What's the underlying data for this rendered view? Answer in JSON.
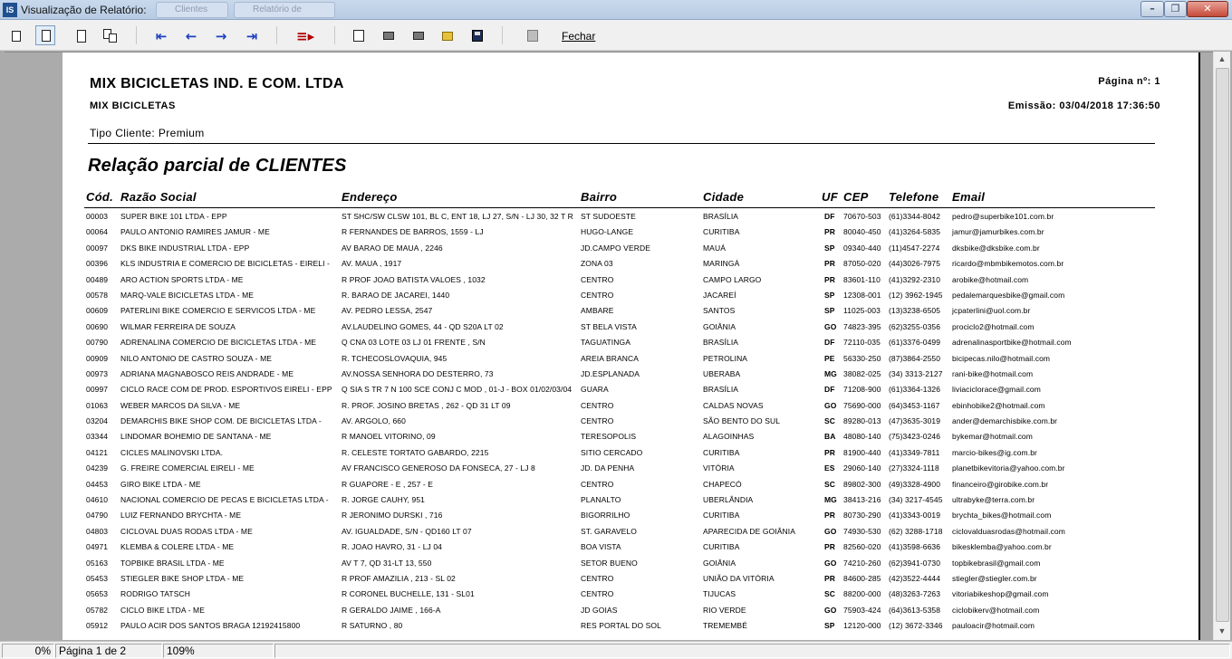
{
  "window": {
    "title": "Visualização de Relatório:",
    "ghost_tabs": [
      "Clientes",
      "Relatório de Clientes"
    ],
    "min_glyph": "–",
    "max_glyph": "❐",
    "close_glyph": "✕"
  },
  "toolbar": {
    "fechar_label": "Fechar",
    "icons": [
      "single-page-icon",
      "page-width-icon",
      "full-page-icon",
      "multi-page-icon",
      "first-page-icon",
      "previous-page-icon",
      "next-page-icon",
      "last-page-icon",
      "goto-page-icon",
      "copy-icon",
      "print-setup-icon",
      "print-icon",
      "open-icon",
      "save-icon",
      "export-icon"
    ]
  },
  "report": {
    "company": "MIX BICICLETAS IND. E COM. LTDA",
    "subcompany": "MIX BICICLETAS",
    "page_number": "Página nº: 1",
    "emission": "Emissão: 03/04/2018 17:36:50",
    "tipo_cliente": "Tipo Cliente: Premium",
    "title": "Relação parcial de CLIENTES",
    "columns": {
      "cod": "Cód.",
      "razao": "Razão Social",
      "endereco": "Endereço",
      "bairro": "Bairro",
      "cidade": "Cidade",
      "uf": "UF",
      "cep": "CEP",
      "telefone": "Telefone",
      "email": "Email"
    },
    "rows": [
      [
        "00003",
        "SUPER BIKE 101 LTDA - EPP",
        "ST SHC/SW CLSW 101, BL C, ENT 18, LJ 27, S/N - LJ 30, 32 T R",
        "ST SUDOESTE",
        "BRASÍLIA",
        "DF",
        "70670-503",
        "(61)3344-8042",
        "pedro@superbike101.com.br"
      ],
      [
        "00064",
        "PAULO ANTONIO RAMIRES JAMUR - ME",
        "R FERNANDES DE BARROS, 1559 - LJ",
        "HUGO-LANGE",
        "CURITIBA",
        "PR",
        "80040-450",
        "(41)3264-5835",
        "jamur@jamurbikes.com.br"
      ],
      [
        "00097",
        "DKS BIKE INDUSTRIAL LTDA - EPP",
        "AV BARAO DE MAUA , 2246",
        "JD.CAMPO VERDE",
        "MAUÁ",
        "SP",
        "09340-440",
        "(11)4547-2274",
        "dksbike@dksbike.com.br"
      ],
      [
        "00396",
        "KLS INDUSTRIA E COMERCIO DE BICICLETAS - EIRELI -",
        "AV. MAUA , 1917",
        "ZONA 03",
        "MARINGÁ",
        "PR",
        "87050-020",
        "(44)3026-7975",
        "ricardo@mbmbikemotos.com.br"
      ],
      [
        "00489",
        "ARO ACTION SPORTS LTDA - ME",
        "R PROF JOAO BATISTA VALOES , 1032",
        "CENTRO",
        "CAMPO LARGO",
        "PR",
        "83601-110",
        "(41)3292-2310",
        "arobike@hotmail.com"
      ],
      [
        "00578",
        "MARQ-VALE BICICLETAS LTDA - ME",
        "R. BARAO DE JACAREI, 1440",
        "CENTRO",
        "JACAREÍ",
        "SP",
        "12308-001",
        "(12) 3962-1945",
        "pedalemarquesbike@gmail.com"
      ],
      [
        "00609",
        "PATERLINI BIKE COMERCIO E SERVICOS LTDA - ME",
        "AV. PEDRO LESSA, 2547",
        "AMBARE",
        "SANTOS",
        "SP",
        "11025-003",
        "(13)3238-6505",
        "jcpaterlini@uol.com.br"
      ],
      [
        "00690",
        "WILMAR FERREIRA DE SOUZA",
        "AV.LAUDELINO GOMES, 44 - QD S20A LT 02",
        "ST BELA VISTA",
        "GOIÂNIA",
        "GO",
        "74823-395",
        "(62)3255-0356",
        "prociclo2@hotmail.com"
      ],
      [
        "00790",
        "ADRENALINA COMERCIO DE BICICLETAS LTDA - ME",
        "Q CNA 03 LOTE 03 LJ 01 FRENTE , S/N",
        "TAGUATINGA",
        "BRASÍLIA",
        "DF",
        "72110-035",
        "(61)3376-0499",
        "adrenalinasportbike@hotmail.com"
      ],
      [
        "00909",
        "NILO ANTONIO DE CASTRO SOUZA - ME",
        "R. TCHECOSLOVAQUIA, 945",
        "AREIA BRANCA",
        "PETROLINA",
        "PE",
        "56330-250",
        "(87)3864-2550",
        "bicipecas.nilo@hotmail.com"
      ],
      [
        "00973",
        "ADRIANA MAGNABOSCO REIS ANDRADE - ME",
        "AV.NOSSA SENHORA DO DESTERRO, 73",
        "JD.ESPLANADA",
        "UBERABA",
        "MG",
        "38082-025",
        "(34) 3313-2127",
        "rani-bike@hotmail.com"
      ],
      [
        "00997",
        "CICLO RACE COM DE PROD. ESPORTIVOS EIRELI - EPP",
        "Q SIA S TR 7 N 100 SCE CONJ C MOD , 01-J - BOX 01/02/03/04",
        "GUARA",
        "BRASÍLIA",
        "DF",
        "71208-900",
        "(61)3364-1326",
        "liviaciclorace@gmail.com"
      ],
      [
        "01063",
        "WEBER MARCOS DA SILVA - ME",
        "R. PROF. JOSINO BRETAS , 262 - QD 31 LT 09",
        "CENTRO",
        "CALDAS NOVAS",
        "GO",
        "75690-000",
        "(64)3453-1167",
        "ebinhobike2@hotmail.com"
      ],
      [
        "03204",
        "DEMARCHIS BIKE SHOP COM. DE BICICLETAS LTDA -",
        "AV. ARGOLO, 660",
        "CENTRO",
        "SÃO BENTO DO SUL",
        "SC",
        "89280-013",
        "(47)3635-3019",
        "ander@demarchisbike.com.br"
      ],
      [
        "03344",
        "LINDOMAR BOHEMIO DE SANTANA - ME",
        "R MANOEL VITORINO, 09",
        "TERESOPOLIS",
        "ALAGOINHAS",
        "BA",
        "48080-140",
        "(75)3423-0246",
        "bykemar@hotmail.com"
      ],
      [
        "04121",
        "CICLES MALINOVSKI LTDA.",
        "R. CELESTE TORTATO GABARDO, 2215",
        "SITIO CERCADO",
        "CURITIBA",
        "PR",
        "81900-440",
        "(41)3349-7811",
        "marcio-bikes@ig.com.br"
      ],
      [
        "04239",
        "G. FREIRE COMERCIAL EIRELI - ME",
        "AV FRANCISCO GENEROSO DA FONSECA, 27 - LJ 8",
        "JD. DA PENHA",
        "VITÓRIA",
        "ES",
        "29060-140",
        "(27)3324-1118",
        "planetbikevitoria@yahoo.com.br"
      ],
      [
        "04453",
        "GIRO BIKE LTDA - ME",
        "R GUAPORE - E , 257 - E",
        "CENTRO",
        "CHAPECÓ",
        "SC",
        "89802-300",
        "(49)3328-4900",
        "financeiro@girobike.com.br"
      ],
      [
        "04610",
        "NACIONAL COMERCIO DE PECAS E BICICLETAS LTDA -",
        "R. JORGE CAUHY, 951",
        "PLANALTO",
        "UBERLÂNDIA",
        "MG",
        "38413-216",
        "(34) 3217-4545",
        "ultrabyke@terra.com.br"
      ],
      [
        "04790",
        "LUIZ FERNANDO BRYCHTA - ME",
        "R JERONIMO DURSKI , 716",
        "BIGORRILHO",
        "CURITIBA",
        "PR",
        "80730-290",
        "(41)3343-0019",
        "brychta_bikes@hotmail.com"
      ],
      [
        "04803",
        "CICLOVAL DUAS RODAS LTDA - ME",
        "AV. IGUALDADE, S/N - QD160 LT 07",
        "ST. GARAVELO",
        "APARECIDA DE GOIÂNIA",
        "GO",
        "74930-530",
        "(62) 3288-1718",
        "ciclovalduasrodas@hotmail.com"
      ],
      [
        "04971",
        "KLEMBA & COLERE LTDA - ME",
        "R. JOAO HAVRO, 31 - LJ 04",
        "BOA VISTA",
        "CURITIBA",
        "PR",
        "82560-020",
        "(41)3598-6636",
        "bikesklemba@yahoo.com.br"
      ],
      [
        "05163",
        "TOPBIKE BRASIL LTDA - ME",
        "AV T 7,   QD 31-LT 13, 550",
        "SETOR BUENO",
        "GOIÂNIA",
        "GO",
        "74210-260",
        "(62)3941-0730",
        "topbikebrasil@gmail.com"
      ],
      [
        "05453",
        "STIEGLER BIKE SHOP LTDA - ME",
        "R PROF AMAZILIA , 213 - SL 02",
        "CENTRO",
        "UNIÃO DA VITÓRIA",
        "PR",
        "84600-285",
        "(42)3522-4444",
        "stiegler@stiegler.com.br"
      ],
      [
        "05653",
        "RODRIGO TATSCH",
        "R CORONEL BUCHELLE, 131 - SL01",
        "CENTRO",
        "TIJUCAS",
        "SC",
        "88200-000",
        "(48)3263-7263",
        "vitoriabikeshop@gmail.com"
      ],
      [
        "05782",
        "CICLO BIKE LTDA - ME",
        "R GERALDO JAIME , 166-A",
        "JD GOIAS",
        "RIO VERDE",
        "GO",
        "75903-424",
        "(64)3613-5358",
        "ciclobikerv@hotmail.com"
      ],
      [
        "05912",
        "PAULO ACIR DOS SANTOS BRAGA 12192415800",
        "R SATURNO , 80",
        "RES PORTAL DO SOL",
        "TREMEMBÉ",
        "SP",
        "12120-000",
        "(12) 3672-3346",
        "pauloacir@hotmail.com"
      ]
    ]
  },
  "statusbar": {
    "progress": "0%",
    "page": "Página 1 de 2",
    "zoom": "109%"
  }
}
